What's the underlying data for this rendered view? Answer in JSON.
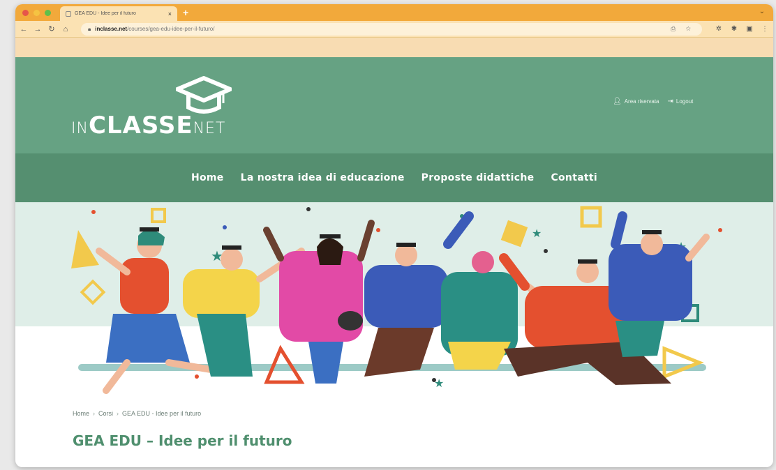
{
  "browser": {
    "tab_title": "GEA EDU - Idee per il futuro",
    "tab_close": "×",
    "new_tab": "+",
    "url_host": "inclasse.net",
    "url_path": "/courses/gea-edu-idee-per-il-futuro/",
    "icons": [
      "back-arrow-icon",
      "forward-arrow-icon",
      "reload-icon",
      "home-icon",
      "lock-icon",
      "extensions-icon",
      "profile-icon",
      "menu-icon"
    ]
  },
  "site": {
    "logo": {
      "in": "IN",
      "classe": "CLASSE",
      "net": "NET"
    },
    "user_links": {
      "reserved_area": "Area riservata",
      "logout": "Logout"
    },
    "nav": [
      "Home",
      "La nostra idea di educazione",
      "Proposte didattiche",
      "Contatti"
    ]
  },
  "breadcrumb": [
    "Home",
    "Corsi",
    "GEA EDU - Idee per il futuro"
  ],
  "breadcrumb_sep": "›",
  "page_title": "GEA EDU – Idee per il futuro",
  "colors": {
    "header_green": "#66a283",
    "nav_green": "#558f70",
    "title_green": "#4f8f6e",
    "browser_orange": "#f2a93b"
  }
}
